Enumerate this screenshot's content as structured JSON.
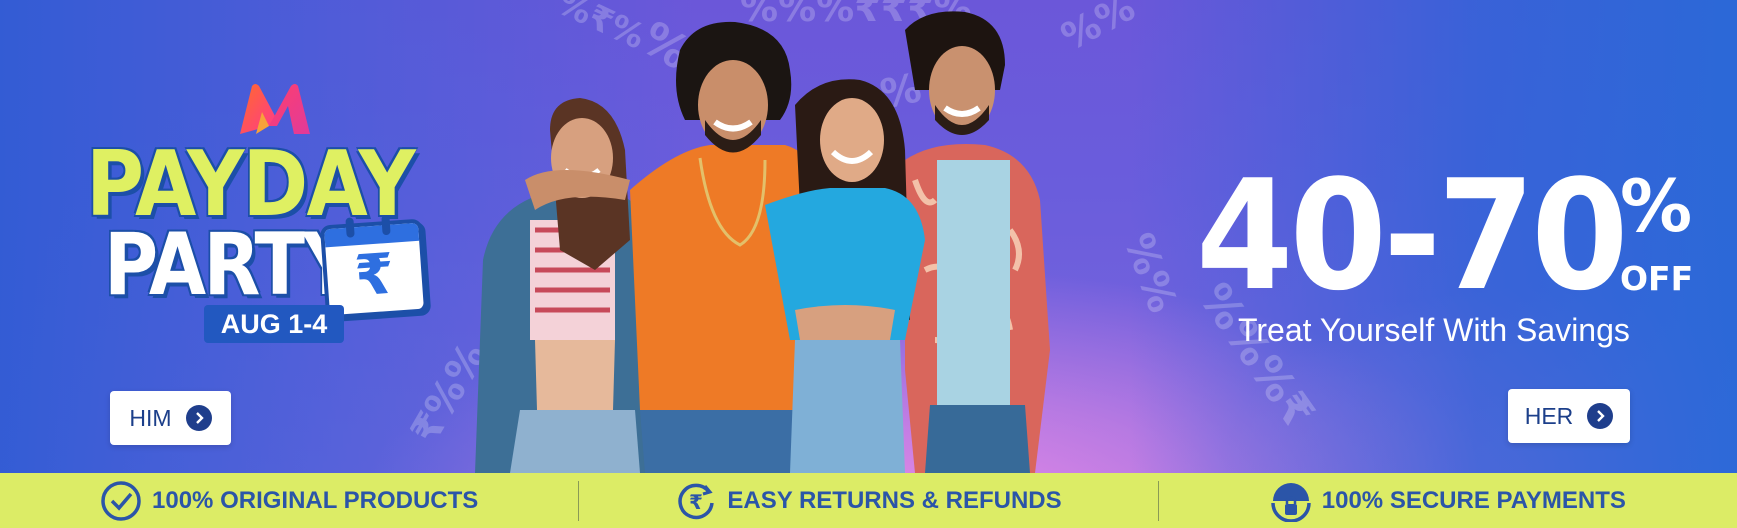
{
  "banner": {
    "brand_logo": "myntra-logo",
    "event_title_line1": "PAYDAY",
    "event_title_line2": "PARTY",
    "event_dates": "AUG 1-4",
    "calendar_symbol": "₹",
    "discount_range": "40-70",
    "discount_percent": "%",
    "discount_suffix": "OFF",
    "tagline": "Treat Yourself With Savings",
    "cta_him": "HIM",
    "cta_her": "HER",
    "colors": {
      "blue": "#2f63d4",
      "purple": "#6a5ddc",
      "pink": "#e98ae6",
      "lime": "#dff062",
      "dark_blue": "#1c4fa8"
    }
  },
  "trust_bar": {
    "items": [
      {
        "icon": "check-circle-icon",
        "label": "100% ORIGINAL PRODUCTS"
      },
      {
        "icon": "rupee-return-icon",
        "label": "EASY RETURNS & REFUNDS"
      },
      {
        "icon": "lock-icon",
        "label": "100% SECURE PAYMENTS"
      }
    ]
  }
}
